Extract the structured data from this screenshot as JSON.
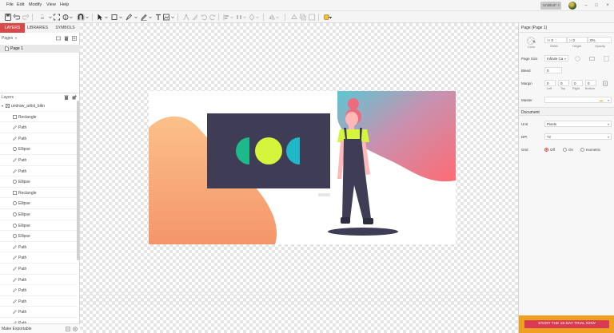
{
  "menu": {
    "file": "File",
    "edit": "Edit",
    "modify": "Modify",
    "view": "View",
    "help": "Help"
  },
  "window": {
    "document_tab": "Untitled*",
    "close_tab": "×",
    "minimize": "–",
    "maximize": "□",
    "close": "×"
  },
  "toolbar": {
    "zoom_value": "50"
  },
  "left_panel": {
    "tabs": [
      "LAYERS",
      "LIBRARIES",
      "SYMBOLS"
    ],
    "pages_label": "Pages",
    "pages": [
      "Page 1"
    ],
    "layers_label": "Layers",
    "root_layer": "undraw_artist_bikn",
    "layers": [
      {
        "name": "Rectangle",
        "icon": "rectangle-icon"
      },
      {
        "name": "Path",
        "icon": "pen-icon"
      },
      {
        "name": "Path",
        "icon": "pen-icon"
      },
      {
        "name": "Ellipse",
        "icon": "ellipse-icon"
      },
      {
        "name": "Path",
        "icon": "pen-icon"
      },
      {
        "name": "Path",
        "icon": "pen-icon"
      },
      {
        "name": "Ellipse",
        "icon": "ellipse-icon"
      },
      {
        "name": "Rectangle",
        "icon": "rectangle-icon"
      },
      {
        "name": "Ellipse",
        "icon": "ellipse-icon"
      },
      {
        "name": "Ellipse",
        "icon": "ellipse-icon"
      },
      {
        "name": "Ellipse",
        "icon": "ellipse-icon"
      },
      {
        "name": "Ellipse",
        "icon": "ellipse-icon"
      },
      {
        "name": "Path",
        "icon": "pen-icon"
      },
      {
        "name": "Path",
        "icon": "pen-icon"
      },
      {
        "name": "Path",
        "icon": "pen-icon"
      },
      {
        "name": "Path",
        "icon": "pen-icon"
      },
      {
        "name": "Path",
        "icon": "pen-icon"
      },
      {
        "name": "Path",
        "icon": "pen-icon"
      },
      {
        "name": "Path",
        "icon": "pen-icon"
      },
      {
        "name": "Path",
        "icon": "pen-icon"
      }
    ],
    "footer_label": "Make Exportable"
  },
  "right_panel": {
    "title": "Page (Page 1)",
    "color_label": "Color",
    "width_prefix": "W",
    "width_value": "0",
    "width_label": "Width",
    "height_prefix": "H",
    "height_value": "0",
    "height_label": "Height",
    "opacity_value": "0%",
    "opacity_label": "Opacity",
    "page_size_label": "Page Size",
    "page_size_value": "Infinite Ca",
    "bleed_label": "Bleed",
    "bleed_value": "0",
    "margin_label": "Margin",
    "margin_values": [
      "0",
      "0",
      "0",
      "0"
    ],
    "margin_sub_labels": [
      "Left",
      "Top",
      "Right",
      "Bottom"
    ],
    "master_label": "Master",
    "master_value": "",
    "document_section": "Document",
    "unit_label": "Unit",
    "unit_value": "Pixels",
    "dpi_label": "DPI",
    "dpi_value": "72",
    "grid_label": "Grid",
    "grid_options": [
      "Off",
      "On",
      "Isometric"
    ],
    "grid_selected": "Off",
    "trial_button": "START THE 15-DAY TRIAL NOW"
  },
  "colors": {
    "accent": "#d84a4a",
    "trial_bar": "#f0a020",
    "trial_button": "#d93a54",
    "illustration_dark": "#3f3d56",
    "illustration_green": "#d4f53c",
    "illustration_teal": "#1fb8c8",
    "illustration_hair": "#f06a7e"
  }
}
